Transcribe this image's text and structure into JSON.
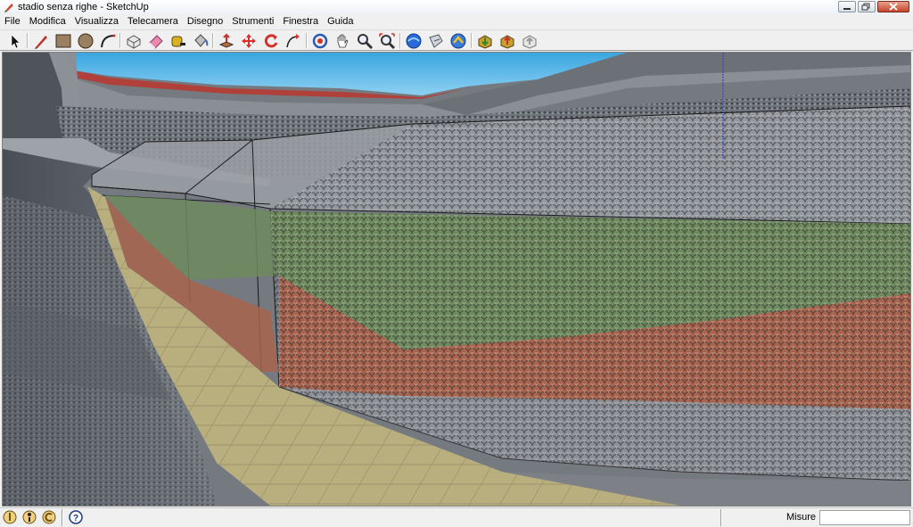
{
  "window": {
    "title": "stadio senza righe - SketchUp"
  },
  "menubar": {
    "items": [
      "File",
      "Modifica",
      "Visualizza",
      "Telecamera",
      "Disegno",
      "Strumenti",
      "Finestra",
      "Guida"
    ]
  },
  "toolbar": {
    "tools": [
      "select-tool-icon",
      "pencil-line-tool-icon",
      "rectangle-tool-icon",
      "circle-tool-icon",
      "arc-tool-icon",
      "make-component-icon",
      "eraser-tool-icon",
      "tape-measure-icon",
      "paint-bucket-icon",
      "push-pull-tool-icon",
      "move-tool-icon",
      "rotate-tool-icon",
      "follow-me-tool-icon",
      "orbit-tool-icon",
      "pan-tool-icon",
      "zoom-tool-icon",
      "zoom-extents-icon",
      "previous-view-icon",
      "next-view-icon",
      "warehouse-icon",
      "get-models-icon",
      "share-model-icon",
      "share-component-icon"
    ]
  },
  "statusbar": {
    "measure_label": "Misure",
    "measure_value": "",
    "icons": [
      "geo-location-icon",
      "credits-icon",
      "user-icon",
      "help-icon"
    ]
  },
  "colors": {
    "sky": "#5cb8e8",
    "stand_red": "#b0403a",
    "field_green": "#6f8a5e",
    "track_red": "#a8644e",
    "floor_tan": "#b9ae7e"
  }
}
